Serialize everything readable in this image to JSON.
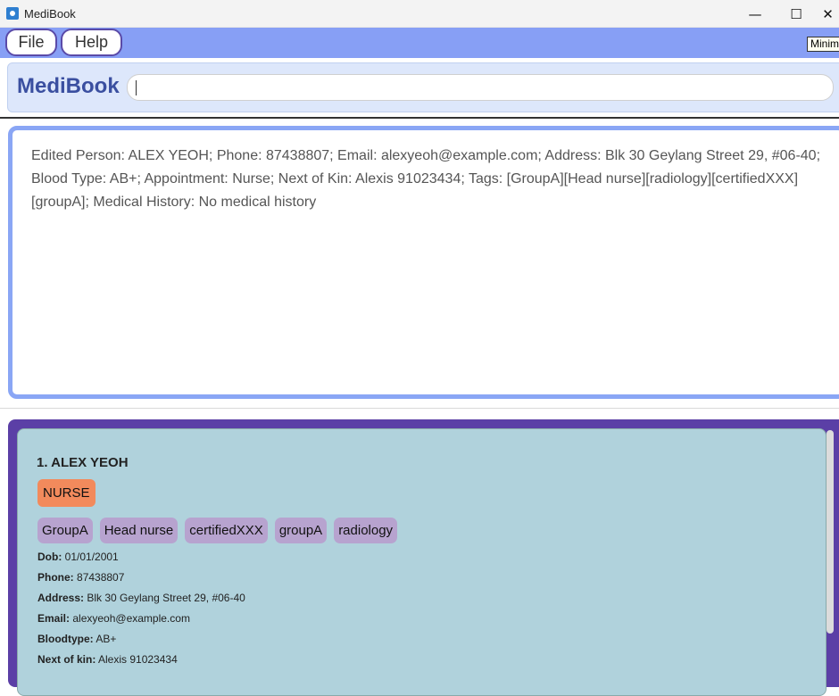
{
  "window": {
    "title": "MediBook",
    "minimize_glyph": "—",
    "maximize_glyph": "☐",
    "close_glyph": "✕"
  },
  "menu": {
    "file": "File",
    "help": "Help",
    "tooltip": "Minim"
  },
  "command": {
    "brand": "MediBook",
    "value": ""
  },
  "result": {
    "text": "Edited Person: ALEX YEOH; Phone: 87438807; Email: alexyeoh@example.com; Address: Blk 30 Geylang Street 29, #06-40; Blood Type: AB+; Appointment: Nurse; Next of Kin: Alexis 91023434; Tags: [GroupA][Head nurse][radiology][certifiedXXX][groupA]; Medical History: No medical history"
  },
  "person": {
    "name": "1.  ALEX YEOH",
    "appointment": "NURSE",
    "tags": [
      "GroupA",
      "Head nurse",
      "certifiedXXX",
      "groupA",
      "radiology"
    ],
    "fields": [
      {
        "label": "Dob:",
        "value": "01/01/2001"
      },
      {
        "label": "Phone:",
        "value": "87438807"
      },
      {
        "label": "Address:",
        "value": "Blk 30 Geylang Street 29, #06-40"
      },
      {
        "label": "Email:",
        "value": "alexyeoh@example.com"
      },
      {
        "label": "Bloodtype:",
        "value": "AB+"
      },
      {
        "label": "Next of kin:",
        "value": "Alexis 91023434"
      }
    ]
  }
}
